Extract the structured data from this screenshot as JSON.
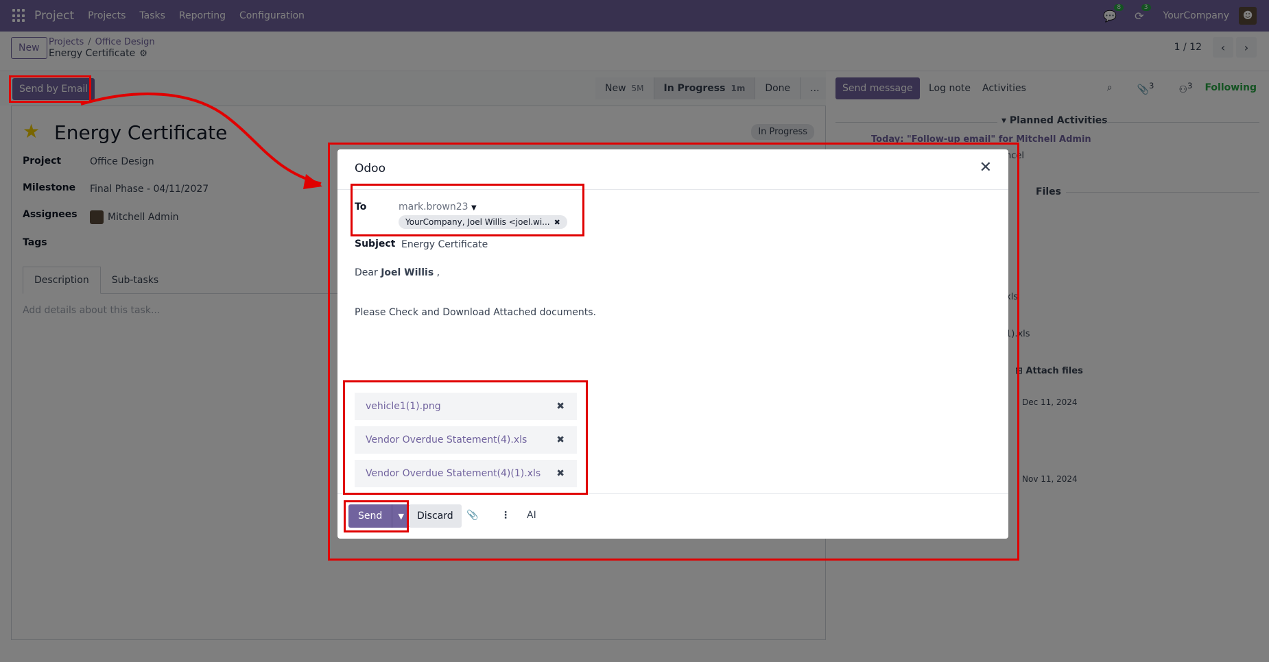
{
  "navbar": {
    "app": "Project",
    "menu": [
      "Projects",
      "Tasks",
      "Reporting",
      "Configuration"
    ],
    "chat_badge": "8",
    "activity_badge": "3",
    "company": "YourCompany"
  },
  "control_panel": {
    "new_label": "New",
    "breadcrumb": [
      "Projects",
      "Office Design"
    ],
    "record": "Energy Certificate",
    "pager": "1 / 12"
  },
  "form": {
    "send_email_label": "Send by Email",
    "stages": [
      {
        "label": "New",
        "time": "5M"
      },
      {
        "label": "In Progress",
        "time": "1m"
      },
      {
        "label": "Done",
        "time": ""
      },
      {
        "label": "...",
        "time": ""
      }
    ],
    "title": "Energy Certificate",
    "state": "In Progress",
    "fields": {
      "project_label": "Project",
      "project_value": "Office Design",
      "milestone_label": "Milestone",
      "milestone_value": "Final Phase - 04/11/2027",
      "assignees_label": "Assignees",
      "assignees_value": "Mitchell Admin",
      "tags_label": "Tags"
    },
    "tabs": [
      "Description",
      "Sub-tasks"
    ],
    "description_placeholder": "Add details about this task..."
  },
  "chatter": {
    "send_message": "Send message",
    "log_note": "Log note",
    "activities": "Activities",
    "attach_count": "3",
    "follower_count": "3",
    "following": "Following",
    "planned_activities": "Planned Activities",
    "activity_line": "Today: \"Follow-up email\"  for Mitchell Admin",
    "activity_sub": "ncel",
    "files": "Files",
    "file1": "xls",
    "file2": "1).xls",
    "attach_files": "Attach files",
    "date1": "Dec 11, 2024",
    "date2": "Nov 11, 2024"
  },
  "dialog": {
    "title": "Odoo",
    "to_label": "To",
    "to_value": "mark.brown23",
    "recipient_tag": "YourCompany, Joel Willis <joel.wi...",
    "subject_label": "Subject",
    "subject_value": "Energy Certificate",
    "greeting_prefix": "Dear ",
    "greeting_name": "Joel Willis",
    "greeting_suffix": " ,",
    "body": "Please Check and Download Attached documents.",
    "attachments": [
      "vehicle1(1).png",
      "Vendor Overdue Statement(4).xls",
      "Vendor Overdue Statement(4)(1).xls"
    ],
    "send_label": "Send",
    "discard_label": "Discard",
    "ai_label": "AI"
  },
  "colors": {
    "brand": "#71639e",
    "annotation": "#e00000",
    "following": "#28a745"
  }
}
